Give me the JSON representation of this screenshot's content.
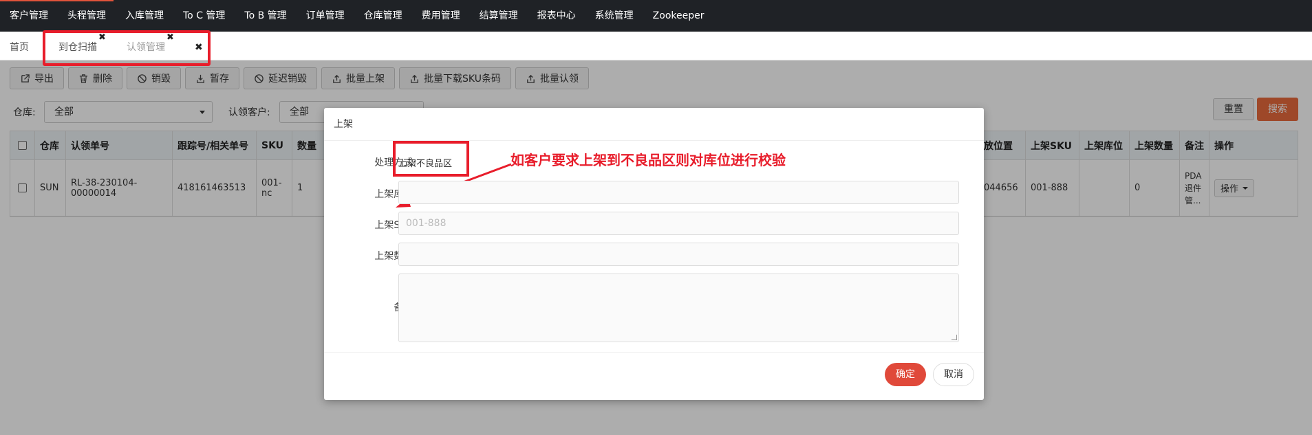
{
  "nav": {
    "items": [
      "客户管理",
      "头程管理",
      "入库管理",
      "To C 管理",
      "To B 管理",
      "订单管理",
      "仓库管理",
      "费用管理",
      "结算管理",
      "报表中心",
      "系统管理",
      "Zookeeper"
    ],
    "accent_color": "#e0533b"
  },
  "tabs": {
    "home": "首页",
    "arrival_scan": "到仓扫描",
    "claim_manage": "认领管理",
    "close_glyph": "✖"
  },
  "toolbar": {
    "buttons": [
      {
        "label": "导出",
        "icon": "export-icon"
      },
      {
        "label": "删除",
        "icon": "trash-icon"
      },
      {
        "label": "销毁",
        "icon": "ban-icon"
      },
      {
        "label": "暂存",
        "icon": "download-icon"
      },
      {
        "label": "延迟销毁",
        "icon": "ban-icon"
      },
      {
        "label": "批量上架",
        "icon": "upload-icon"
      },
      {
        "label": "批量下载SKU条码",
        "icon": "upload-icon"
      },
      {
        "label": "批量认领",
        "icon": "upload-icon"
      }
    ]
  },
  "filters": {
    "warehouse_label": "仓库:",
    "warehouse_value": "全部",
    "customer_label": "认领客户:",
    "customer_value": "全部",
    "reset": "重置",
    "search": "搜索",
    "search_color": "#e96b3d"
  },
  "table": {
    "headers_left": [
      "仓库",
      "认领单号",
      "跟踪号/相关单号",
      "SKU",
      "数量"
    ],
    "headers_right": [
      "放位置",
      "上架SKU",
      "上架库位",
      "上架数量",
      "备注",
      "操作"
    ],
    "row_left": [
      "SUN",
      "RL-38-230104-00000014",
      "418161463513",
      "001-nc",
      "1"
    ],
    "row_right": [
      "044656",
      "001-888",
      "",
      "0",
      "PDA 退件 管...",
      ""
    ],
    "op_label": "操作"
  },
  "modal": {
    "title": "上架",
    "mode_label": "处理方式:",
    "mode_value": "上架不良品区",
    "location_label": "上架库位:",
    "sku_label": "上架SKU:",
    "sku_placeholder": "001-888",
    "qty_label": "上架数量:",
    "remark_label": "备注:",
    "annotation": "如客户要求上架到不良品区则对库位进行校验",
    "ok": "确定",
    "cancel": "取消",
    "ok_color": "#e0493a",
    "highlight_color": "#e81d2b"
  }
}
